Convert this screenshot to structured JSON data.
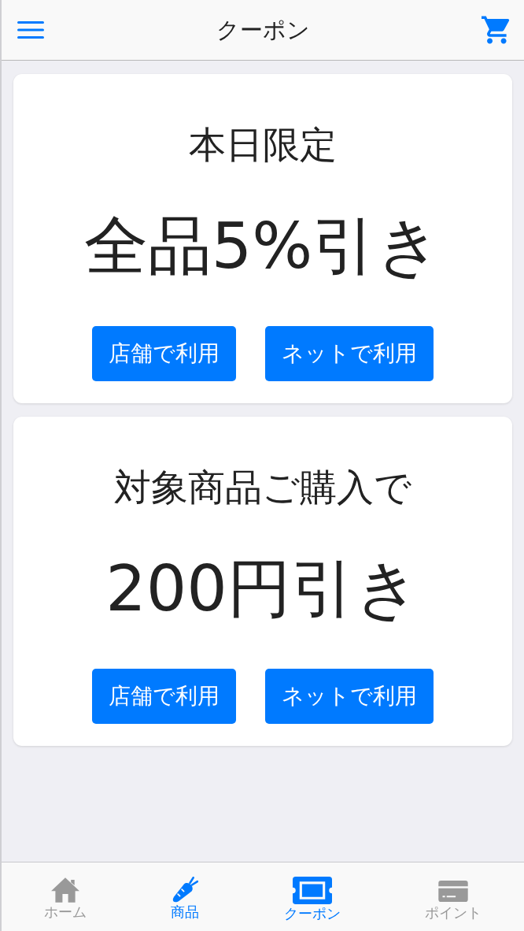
{
  "header": {
    "title": "クーポン"
  },
  "coupons": [
    {
      "condition": "本日限定",
      "discount": "全品5%引き",
      "buttons": [
        "店舗で利用",
        "ネットで利用"
      ]
    },
    {
      "condition": "対象商品ご購入で",
      "discount": "200円引き",
      "buttons": [
        "店舗で利用",
        "ネットで利用"
      ]
    }
  ],
  "tab_bar": [
    {
      "kind": "home",
      "label": "ホーム",
      "selected": false
    },
    {
      "kind": "products",
      "label": "商品",
      "selected": true
    },
    {
      "kind": "coupon",
      "label": "クーポン",
      "selected": true
    },
    {
      "kind": "points",
      "label": "ポイント",
      "selected": false
    }
  ]
}
